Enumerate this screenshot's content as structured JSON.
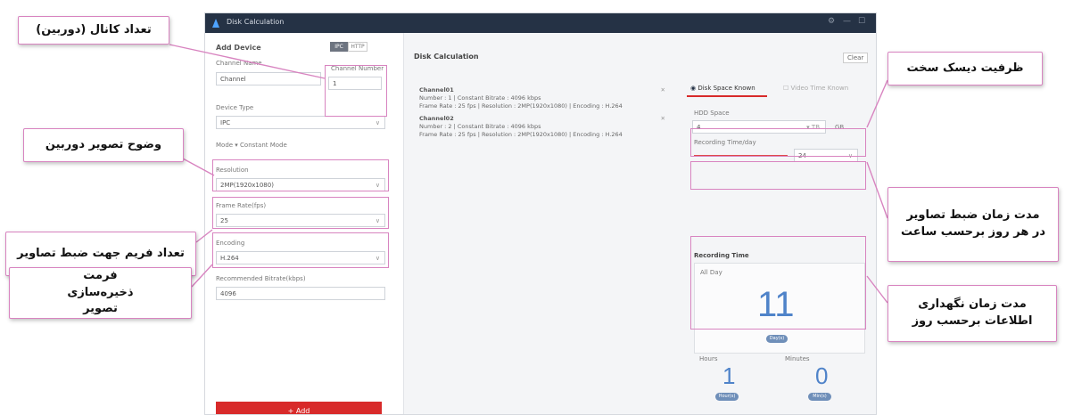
{
  "window": {
    "title": "Disk Calculation",
    "controls": [
      "⚙",
      "—",
      "☐"
    ]
  },
  "left_panel": {
    "title": "Add Device",
    "toggle": [
      "IPC",
      "HTTP"
    ],
    "channel_name": {
      "label": "Channel Name",
      "value": "Channel"
    },
    "channel_number": {
      "label": "Channel Number",
      "value": "1"
    },
    "device_type": {
      "label": "Device Type",
      "value": "IPC"
    },
    "mode_label": "Mode  ▾  Constant Mode",
    "resolution": {
      "label": "Resolution",
      "value": "2MP(1920x1080)"
    },
    "frame_rate": {
      "label": "Frame Rate(fps)",
      "value": "25"
    },
    "encoding": {
      "label": "Encoding",
      "value": "H.264"
    },
    "bitrate": {
      "label": "Recommended Bitrate(kbps)",
      "value": "4096"
    },
    "add_button": "+ Add"
  },
  "center": {
    "title": "Disk Calculation",
    "clear_label": "Clear",
    "cards": [
      {
        "name": "Channel01",
        "line1": "Number : 1    |    Constant Bitrate : 4096 kbps",
        "line2": "Frame Rate : 25 fps  |  Resolution : 2MP(1920x1080)  |  Encoding : H.264"
      },
      {
        "name": "Channel02",
        "line1": "Number : 2    |    Constant Bitrate : 4096 kbps",
        "line2": "Frame Rate : 25 fps  |  Resolution : 2MP(1920x1080)  |  Encoding : H.264"
      }
    ]
  },
  "right_panel": {
    "tab_active": "Disk Space Known",
    "tab_inactive": "Video Time Known",
    "disk_space": {
      "label": "HDD Space",
      "value": "4",
      "unit_tb": "TB",
      "unit_gb": "GB"
    },
    "recording_time": {
      "label": "Recording Time/day",
      "value": "24"
    },
    "result_title": "Recording Time",
    "all_day_label": "All Day",
    "days_value": "11",
    "days_pill": "Day(s)",
    "hours_label": "Hours",
    "hours_value": "1",
    "hours_pill": "Hour(s)",
    "minutes_label": "Minutes",
    "minutes_value": "0",
    "minutes_pill": "Min(s)"
  },
  "callouts": {
    "channel_count": "تعداد کانال (دوربین)",
    "resolution": "وضوح تصویر دوربین",
    "frame_rate": "تعداد فریم جهت ضبط تصاویر",
    "encoding": "فرمت ذخیره‌سازی تصویر",
    "disk_capacity": "ظرفیت دیسک سخت",
    "recording_hours": "مدت زمان ضبط تصاویر در هر روز برحسب ساعت",
    "retention_days": "مدت زمان نگهداری اطلاعات برحسب روز"
  },
  "colors": {
    "accent": "#d82a2a",
    "titlebar": "#253245",
    "highlight": "#d884c0",
    "digits": "#4f83c9"
  }
}
